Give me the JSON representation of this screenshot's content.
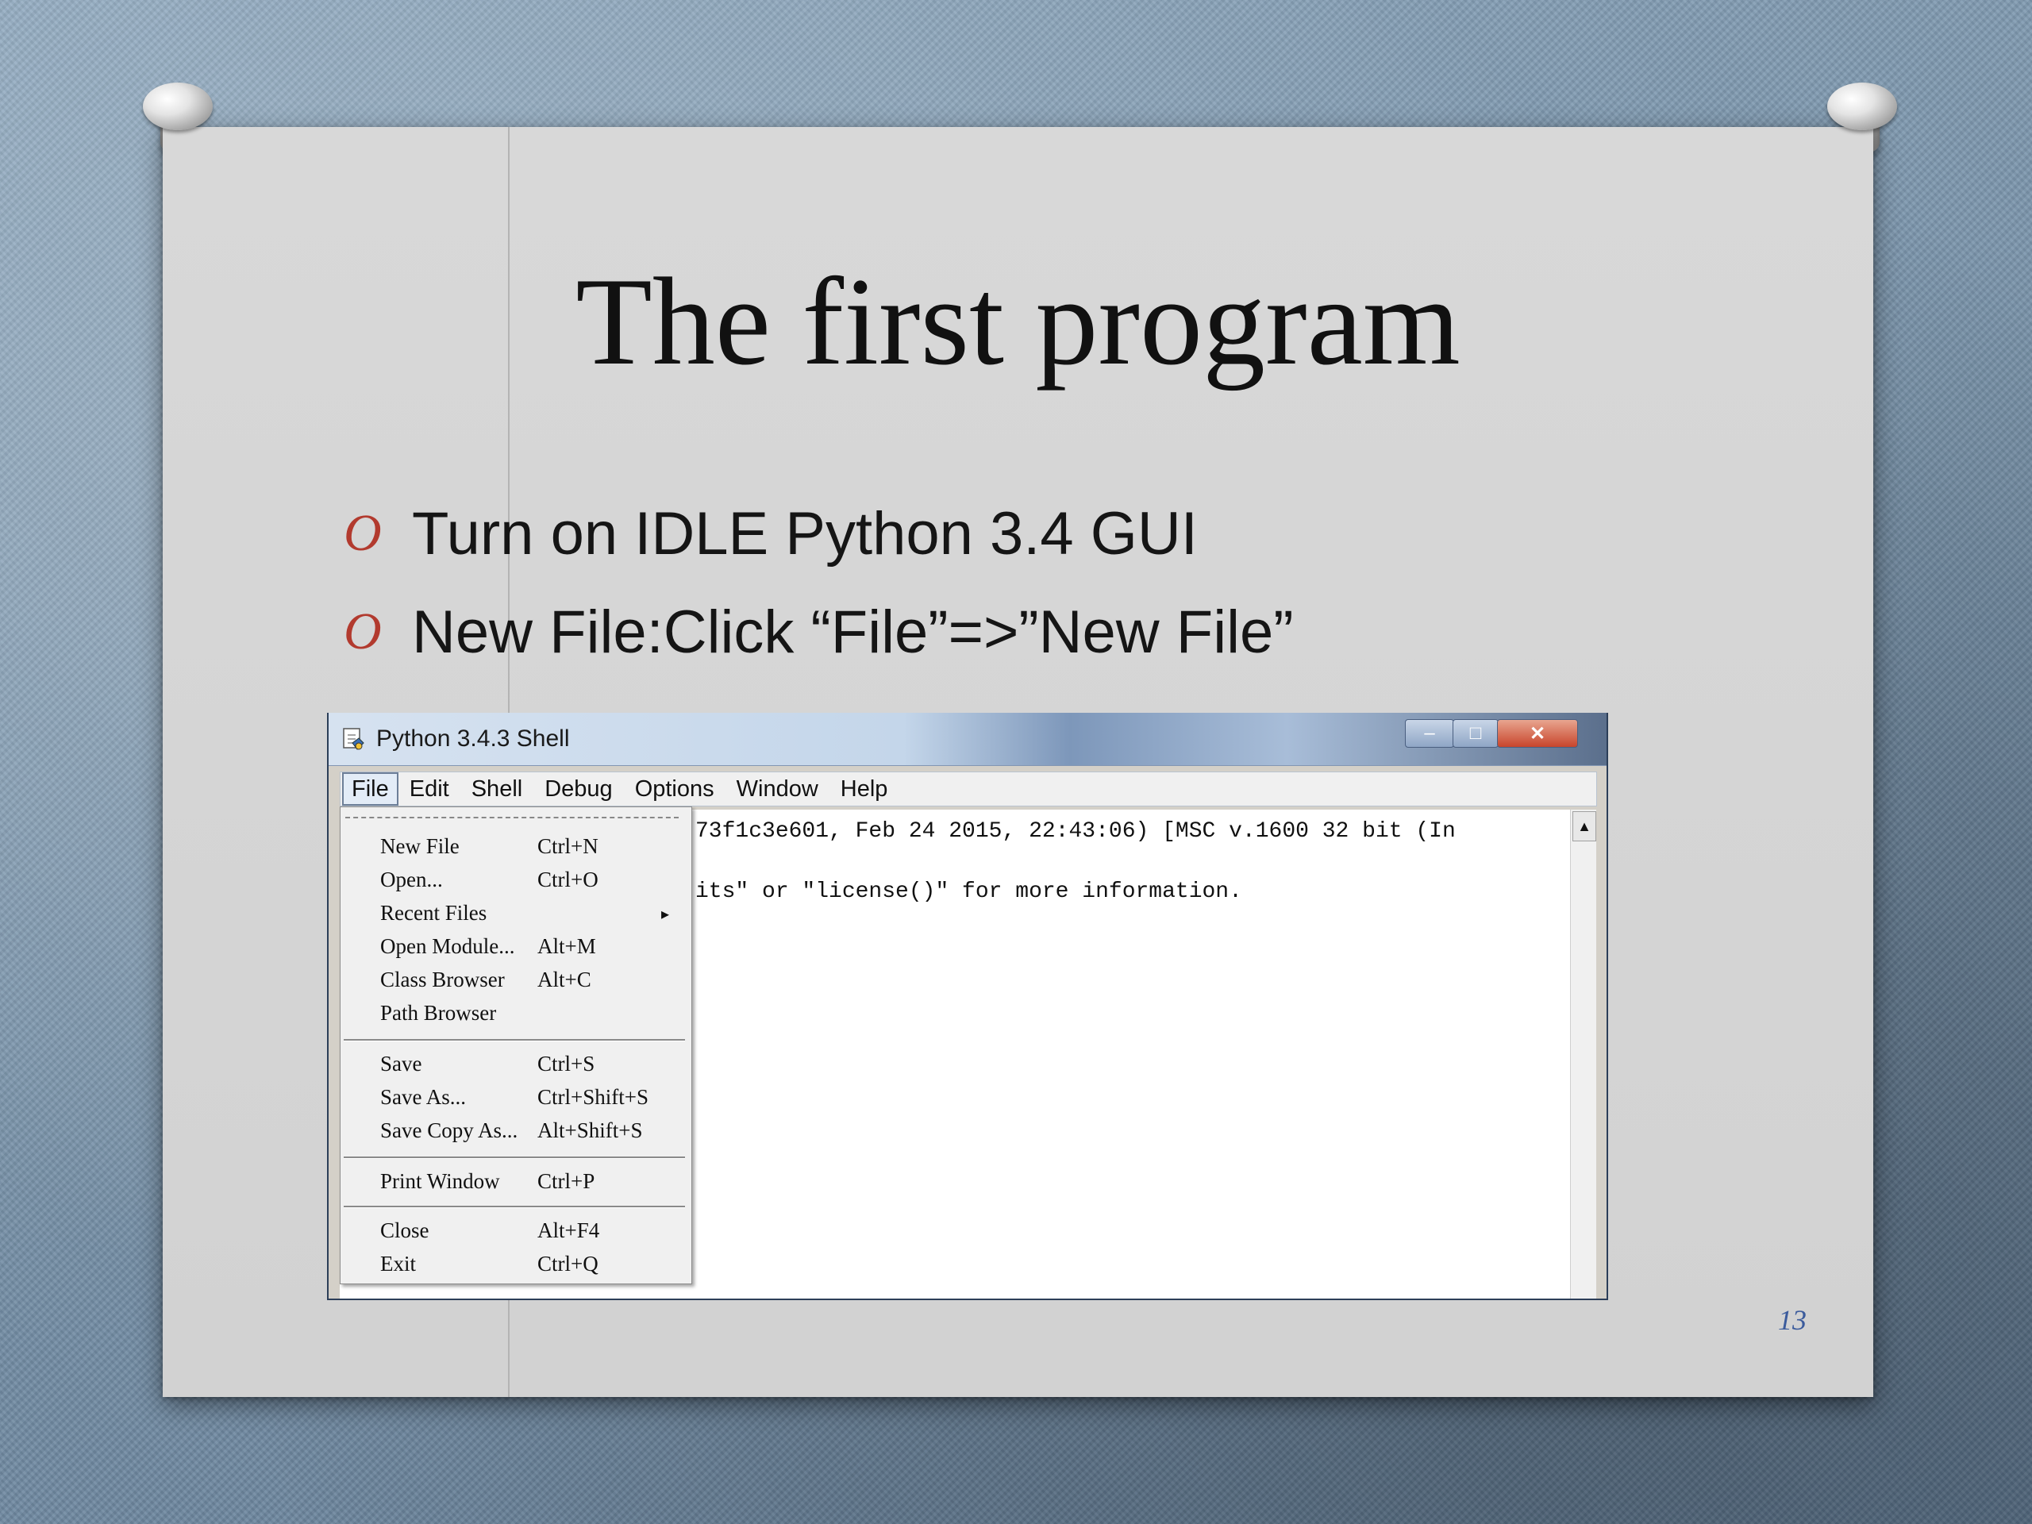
{
  "slide": {
    "title": "The first program",
    "bullets": [
      {
        "mark": "O",
        "text": "Turn on IDLE Python 3.4 GUI"
      },
      {
        "mark": "O",
        "text": "New File:Click “File”=>”New File”"
      }
    ],
    "page_number": "13"
  },
  "window": {
    "title": "Python 3.4.3 Shell",
    "controls": {
      "minimize": "–",
      "maximize": "□",
      "close": "✕"
    },
    "menu": [
      "File",
      "Edit",
      "Shell",
      "Debug",
      "Options",
      "Window",
      "Help"
    ],
    "editor_lines": [
      "73f1c3e601, Feb 24 2015, 22:43:06) [MSC v.1600 32 bit (In",
      "its\" or \"license()\" for more information."
    ],
    "scroll_up": "▲",
    "file_menu": {
      "groups": [
        [
          {
            "label": "New File",
            "accel": "Ctrl+N"
          },
          {
            "label": "Open...",
            "accel": "Ctrl+O"
          },
          {
            "label": "Recent Files",
            "accel": "",
            "submenu": "▸"
          },
          {
            "label": "Open Module...",
            "accel": "Alt+M"
          },
          {
            "label": "Class Browser",
            "accel": "Alt+C"
          },
          {
            "label": "Path Browser",
            "accel": ""
          }
        ],
        [
          {
            "label": "Save",
            "accel": "Ctrl+S"
          },
          {
            "label": "Save As...",
            "accel": "Ctrl+Shift+S"
          },
          {
            "label": "Save Copy As...",
            "accel": "Alt+Shift+S"
          }
        ],
        [
          {
            "label": "Print Window",
            "accel": "Ctrl+P"
          }
        ],
        [
          {
            "label": "Close",
            "accel": "Alt+F4"
          },
          {
            "label": "Exit",
            "accel": "Ctrl+Q"
          }
        ]
      ]
    }
  }
}
